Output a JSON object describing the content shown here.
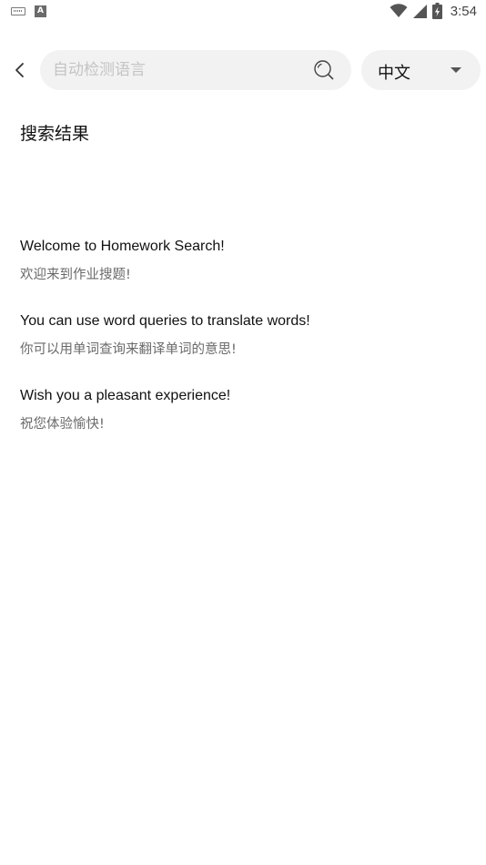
{
  "status_bar": {
    "time": "3:54",
    "icons": [
      "keyboard-icon",
      "a-icon",
      "wifi-icon",
      "signal-icon",
      "battery-icon"
    ],
    "a_icon_label": "A"
  },
  "top_bar": {
    "back_icon": "chevron-left-icon",
    "search": {
      "placeholder": "自动检测语言",
      "value": "",
      "icon": "search-icon"
    },
    "language": {
      "selected": "中文",
      "icon": "caret-down-icon"
    }
  },
  "section_title": "搜索结果",
  "results": [
    {
      "en": "Welcome to Homework Search!",
      "zh": "欢迎来到作业搜题!"
    },
    {
      "en": "You can use word queries to translate words!",
      "zh": "你可以用单词查询来翻译单词的意思!"
    },
    {
      "en": "Wish you a pleasant experience!",
      "zh": "祝您体验愉快!"
    }
  ]
}
